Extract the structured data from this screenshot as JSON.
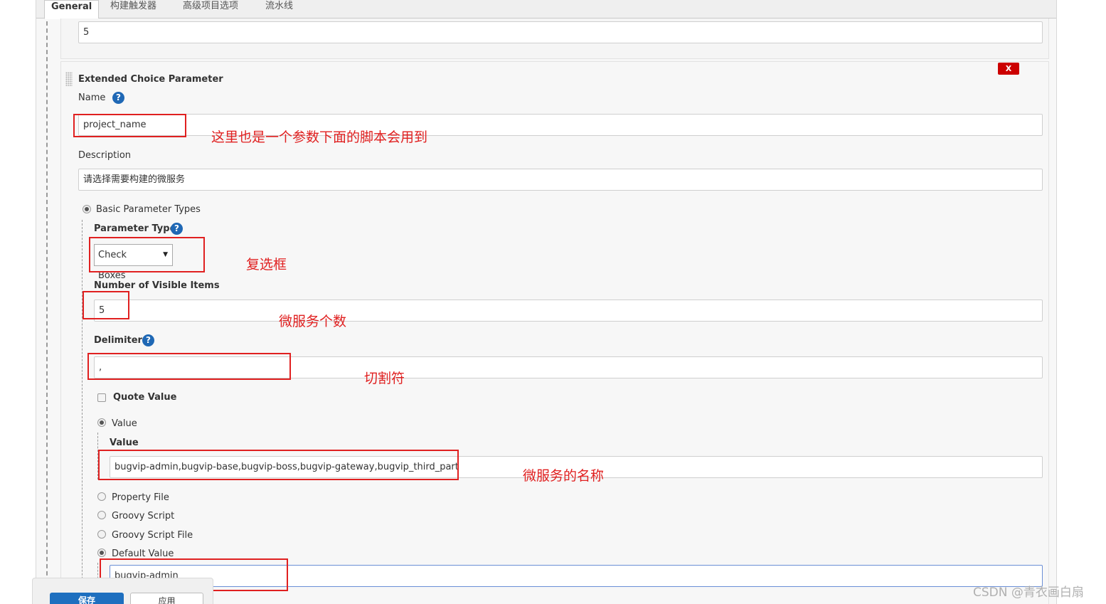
{
  "tabs": [
    {
      "label": "General",
      "active": true
    },
    {
      "label": "构建触发器",
      "active": false
    },
    {
      "label": "高级项目选项",
      "active": false
    },
    {
      "label": "流水线",
      "active": false
    }
  ],
  "top_section": {
    "value": "5"
  },
  "parameter": {
    "title": "Extended Choice Parameter",
    "delete_label": "X",
    "name_label": "Name",
    "name_value": "project_name",
    "description_label": "Description",
    "description_value": "请选择需要构建的微服务",
    "basic_types_label": "Basic Parameter Types",
    "parameter_type_label": "Parameter Type",
    "parameter_type_value": "Check Boxes",
    "visible_items_label": "Number of Visible Items",
    "visible_items_value": "5",
    "delimiter_label": "Delimiter",
    "delimiter_value": ",",
    "quote_value_label": "Quote Value",
    "value_radio_label": "Value",
    "value_field_label": "Value",
    "value_field_value": "bugvip-admin,bugvip-base,bugvip-boss,bugvip-gateway,bugvip_third_part",
    "property_file_label": "Property File",
    "groovy_script_label": "Groovy Script",
    "groovy_script_file_label": "Groovy Script File",
    "default_value_label": "Default Value",
    "default_value_value": "bugvip-admin",
    "help_glyph": "?",
    "select_caret": "▼"
  },
  "annotations": {
    "name_note": "这里也是一个参数下面的脚本会用到",
    "type_note": "复选框",
    "count_note": "微服务个数",
    "delimiter_note": "切割符",
    "value_note": "微服务的名称"
  },
  "buttons": {
    "save": "保存",
    "apply": "应用"
  },
  "watermark": "CSDN @青衣画白扇",
  "colors": {
    "annotation": "#e02020",
    "help_icon": "#1f68b5",
    "primary_button": "#1e6fbf",
    "delete_button": "#cc0000"
  }
}
